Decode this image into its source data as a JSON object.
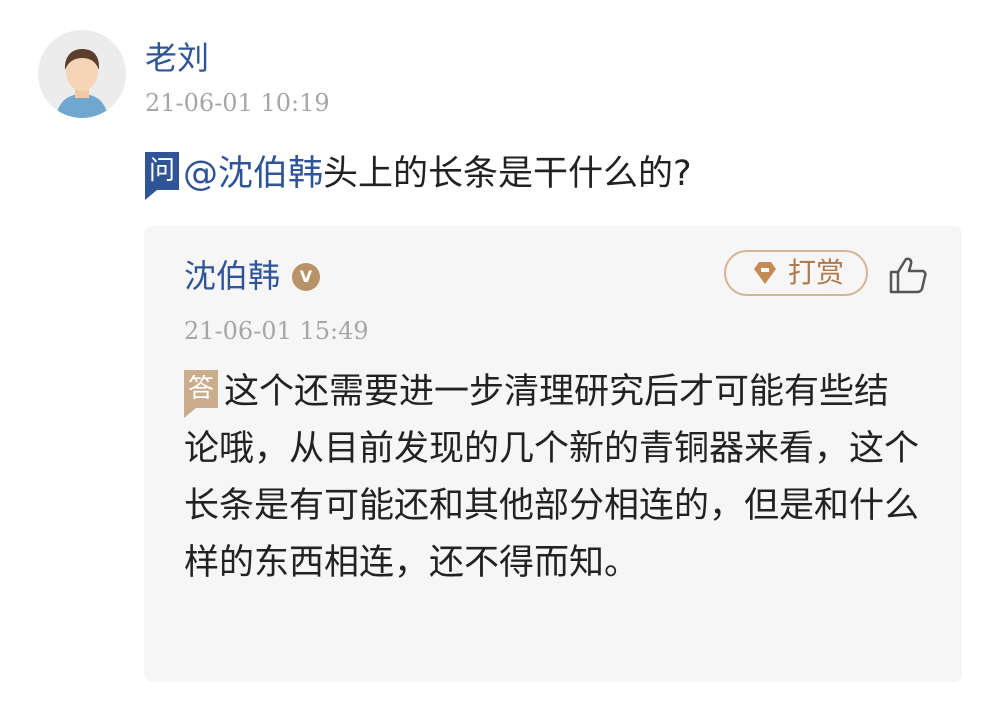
{
  "question": {
    "author": "老刘",
    "time": "21-06-01 10:19",
    "tag": "问",
    "mention": "@沈伯韩",
    "text": "头上的长条是干什么的?"
  },
  "answer": {
    "author": "沈伯韩",
    "verified_badge": "V",
    "time": "21-06-01 15:49",
    "tag": "答",
    "text": "这个还需要进一步清理研究后才可能有些结论哦，从目前发现的几个新的青铜器来看，这个长条是有可能还和其他部分相连的，但是和什么样的东西相连，还不得而知。",
    "reward_label": "打赏"
  },
  "colors": {
    "name_blue": "#2f5597",
    "answer_tag": "#c9ad8c",
    "reward_accent": "#b07a4e",
    "card_bg": "#f6f6f6"
  },
  "icons": [
    "avatar",
    "verified-icon",
    "gem-icon",
    "thumbs-up-icon"
  ]
}
